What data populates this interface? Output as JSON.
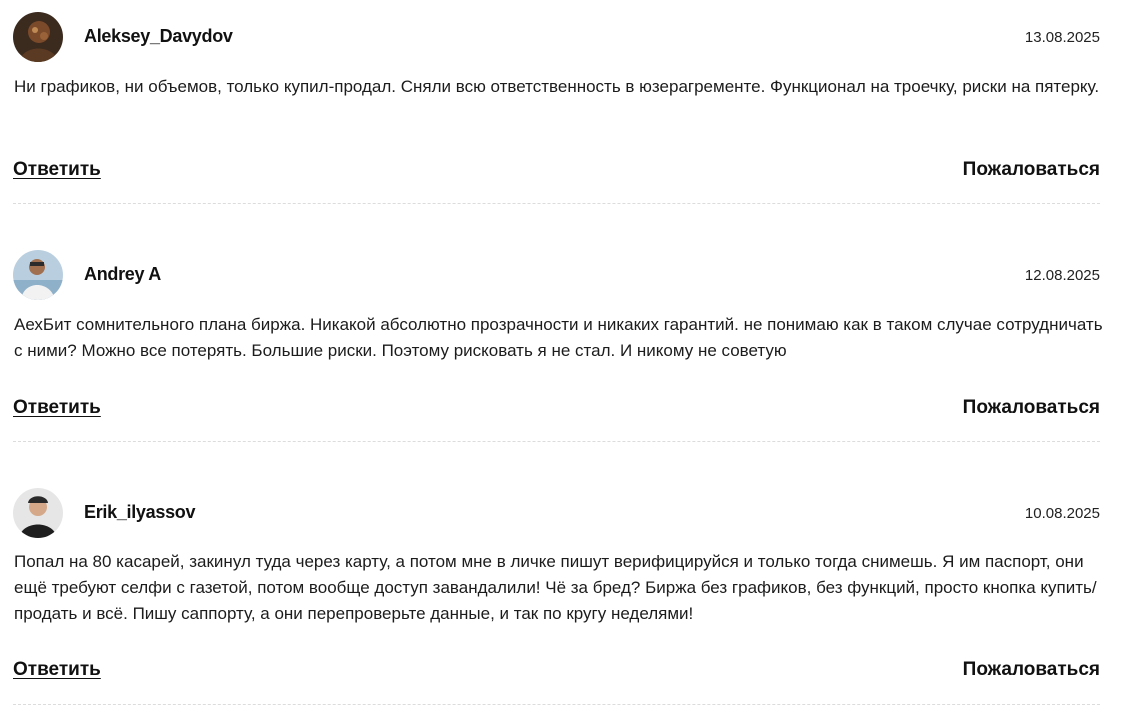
{
  "reviews": [
    {
      "author": "Aleksey_Davydov",
      "date": "13.08.2025",
      "text": "Ни графиков, ни объемов, только купил-продал. Сняли всю ответственность в юзерагременте. Функционал на троечку, риски на пятерку.",
      "reply_label": "Ответить",
      "report_label": "Пожаловаться"
    },
    {
      "author": "Andrey A",
      "date": "12.08.2025",
      "text": "АехБит сомнительного плана биржа. Никакой абсолютно прозрачности и никаких гарантий. не понимаю как в таком случае сотрудничать с ними? Можно все потерять. Большие риски. Поэтому рисковать я не стал. И никому не советую",
      "reply_label": "Ответить",
      "report_label": "Пожаловаться"
    },
    {
      "author": "Erik_ilyassov",
      "date": "10.08.2025",
      "text": "Попал на 80 касарей, закинул туда через карту, а потом мне в личке пишут верифицируйся и только тогда снимешь. Я им паспорт, они ещё требуют селфи с газетой, потом вообще доступ завандалили! Чё за бред? Биржа без графиков, без функций, просто кнопка купить/продать и всё. Пишу саппорту, а они перепроверьте данные, и так по кругу неделями!",
      "reply_label": "Ответить",
      "report_label": "Пожаловаться"
    }
  ]
}
